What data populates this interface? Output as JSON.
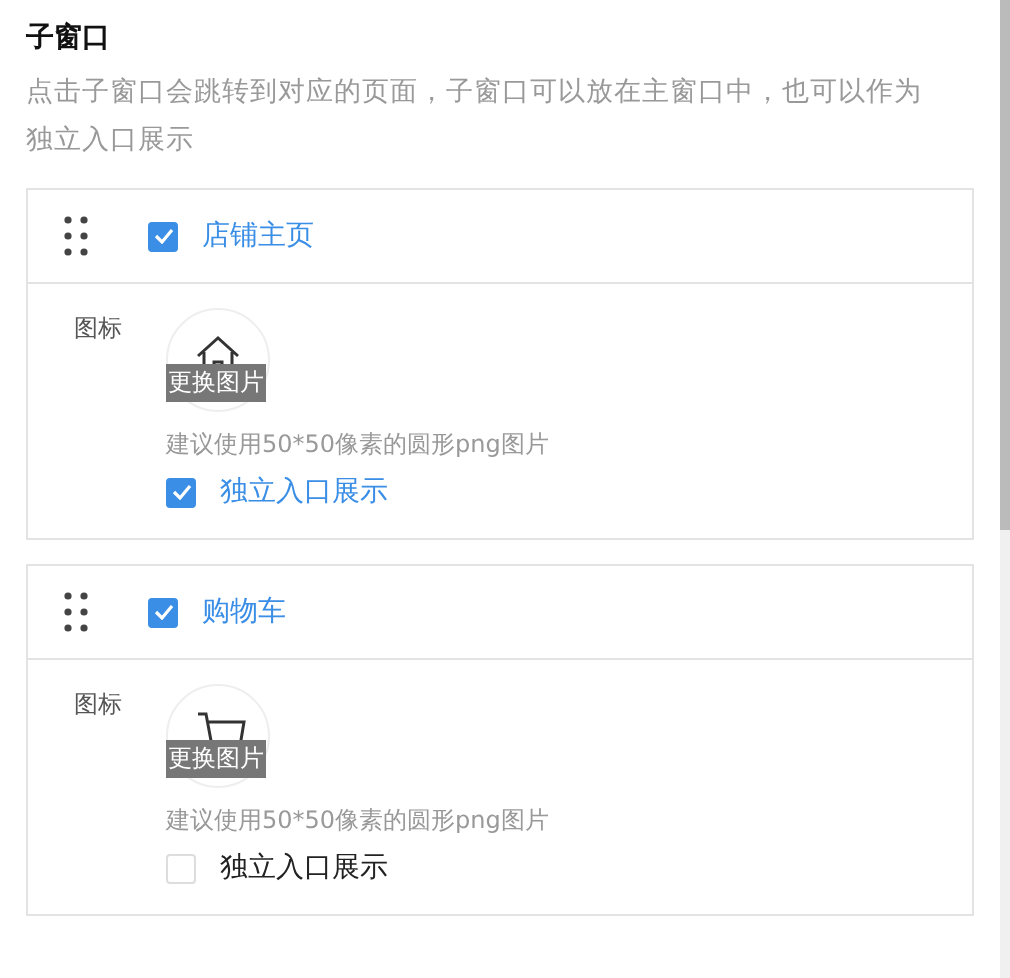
{
  "section": {
    "title": "子窗口",
    "description": "点击子窗口会跳转到对应的页面，子窗口可以放在主窗口中，也可以作为独立入口展示"
  },
  "windows": [
    {
      "name": "店铺主页",
      "checked": true,
      "icon_label": "图标",
      "kind": "house",
      "replace_label": "更换图片",
      "hint": "建议使用50*50像素的圆形png图片",
      "standalone_label": "独立入口展示",
      "standalone": true
    },
    {
      "name": "购物车",
      "checked": true,
      "icon_label": "图标",
      "kind": "cart",
      "replace_label": "更换图片",
      "hint": "建议使用50*50像素的圆形png图片",
      "standalone_label": "独立入口展示",
      "standalone": false
    }
  ]
}
